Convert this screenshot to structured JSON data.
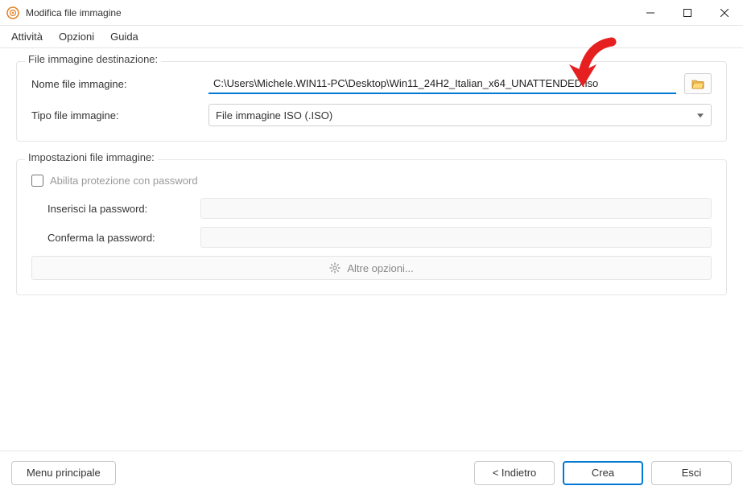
{
  "window": {
    "title": "Modifica file immagine"
  },
  "menubar": {
    "items": [
      "Attività",
      "Opzioni",
      "Guida"
    ]
  },
  "group_dest": {
    "legend": "File immagine destinazione:",
    "filename_label": "Nome file immagine:",
    "filename_value": "C:\\Users\\Michele.WIN11-PC\\Desktop\\Win11_24H2_Italian_x64_UNATTENDED.iso",
    "filetype_label": "Tipo file immagine:",
    "filetype_value": "File immagine ISO (.ISO)"
  },
  "group_settings": {
    "legend": "Impostazioni file immagine:",
    "enable_pw_label": "Abilita protezione con password",
    "enable_pw_checked": false,
    "enter_pw_label": "Inserisci la password:",
    "confirm_pw_label": "Conferma la password:",
    "more_opts_label": "Altre opzioni..."
  },
  "footer": {
    "main_menu": "Menu principale",
    "back": "< Indietro",
    "create": "Crea",
    "exit": "Esci"
  }
}
